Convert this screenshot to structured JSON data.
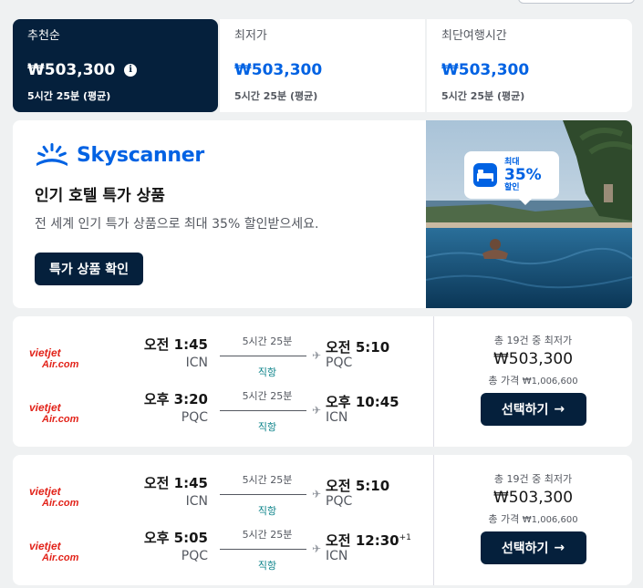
{
  "sort_tabs": [
    {
      "label": "추천순",
      "price": "₩503,300",
      "duration": "5시간 25분 (평균)"
    },
    {
      "label": "최저가",
      "price": "₩503,300",
      "duration": "5시간 25분 (평균)"
    },
    {
      "label": "최단여행시간",
      "price": "₩503,300",
      "duration": "5시간 25분 (평균)"
    }
  ],
  "ad": {
    "brand": "Skyscanner",
    "title": "인기 호텔 특가 상품",
    "subtitle": "전 세계 인기 특가 상품으로 최대 35% 할인받으세요.",
    "button": "특가 상품 확인",
    "badge_top": "최대",
    "badge_pct": "35%",
    "badge_bottom": "할인"
  },
  "flights": [
    {
      "legs": [
        {
          "airline": "VietJet Air",
          "dep_time": "오전 1:45",
          "dep_code": "ICN",
          "duration": "5시간 25분",
          "stops": "직항",
          "arr_time": "오전 5:10",
          "arr_code": "PQC",
          "day_offset": ""
        },
        {
          "airline": "VietJet Air",
          "dep_time": "오후 3:20",
          "dep_code": "PQC",
          "duration": "5시간 25분",
          "stops": "직항",
          "arr_time": "오후 10:45",
          "arr_code": "ICN",
          "day_offset": ""
        }
      ],
      "deal_count": "총 19건 중 최저가",
      "price": "₩503,300",
      "total_label": "총 가격",
      "total": "₩1,006,600",
      "select": "선택하기"
    },
    {
      "legs": [
        {
          "airline": "VietJet Air",
          "dep_time": "오전 1:45",
          "dep_code": "ICN",
          "duration": "5시간 25분",
          "stops": "직항",
          "arr_time": "오전 5:10",
          "arr_code": "PQC",
          "day_offset": ""
        },
        {
          "airline": "VietJet Air",
          "dep_time": "오후 5:05",
          "dep_code": "PQC",
          "duration": "5시간 25분",
          "stops": "직항",
          "arr_time": "오전 12:30",
          "arr_code": "ICN",
          "day_offset": "+1"
        }
      ],
      "deal_count": "총 19건 중 최저가",
      "price": "₩503,300",
      "total_label": "총 가격",
      "total": "₩1,006,600",
      "select": "선택하기"
    }
  ],
  "logo_text": {
    "top": "vietjet",
    "bottom": "Air.com"
  },
  "icons": {
    "info": "i",
    "plane": "✈",
    "arrow": "→"
  },
  "colors": {
    "navy": "#05203c",
    "blue": "#0062e3",
    "teal": "#0c838a",
    "vietjet_red": "#e2231a"
  }
}
